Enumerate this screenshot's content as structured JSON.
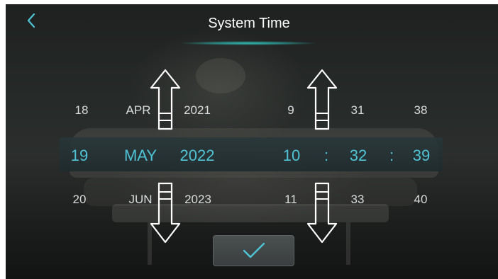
{
  "header": {
    "title": "System Time",
    "back_icon": "chevron-left-icon"
  },
  "picker": {
    "day": {
      "prev": "18",
      "selected": "19",
      "next": "20"
    },
    "month": {
      "prev": "APR",
      "selected": "MAY",
      "next": "JUN"
    },
    "year": {
      "prev": "2021",
      "selected": "2022",
      "next": "2023"
    },
    "hour": {
      "prev": "9",
      "selected": "10",
      "next": "11"
    },
    "minute": {
      "prev": "31",
      "selected": "32",
      "next": "33"
    },
    "second": {
      "prev": "38",
      "selected": "39",
      "next": "40"
    },
    "separator": ":"
  },
  "confirm": {
    "icon": "checkmark-icon"
  },
  "colors": {
    "accent": "#4fc4d6",
    "underline": "#2fb7b0",
    "text": "#d9dcdc"
  }
}
